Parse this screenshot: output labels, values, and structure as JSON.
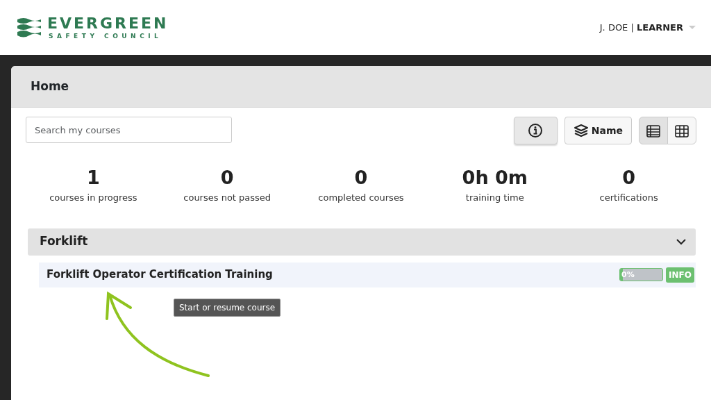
{
  "brand": {
    "name": "EVERGREEN",
    "tagline": "SAFETY COUNCIL"
  },
  "user": {
    "name": "J. DOE",
    "separator": "|",
    "role": "LEARNER"
  },
  "page_title": "Home",
  "search": {
    "placeholder": "Search my courses"
  },
  "toolbar": {
    "info_selected": true,
    "sort_label": "Name",
    "views": [
      {
        "kind": "list",
        "selected": true
      },
      {
        "kind": "grid",
        "selected": false
      }
    ]
  },
  "stats": [
    {
      "value": "1",
      "label": "courses in progress"
    },
    {
      "value": "0",
      "label": "courses not passed"
    },
    {
      "value": "0",
      "label": "completed courses"
    },
    {
      "value": "0h 0m",
      "label": "training time"
    },
    {
      "value": "0",
      "label": "certifications"
    }
  ],
  "categories": [
    {
      "title": "Forklift",
      "expanded": true,
      "courses": [
        {
          "title": "Forklift Operator Certification Training",
          "level": 0,
          "reading": "0%",
          "badge": "INFO"
        }
      ]
    }
  ],
  "tooltip": "Start or resume course"
}
